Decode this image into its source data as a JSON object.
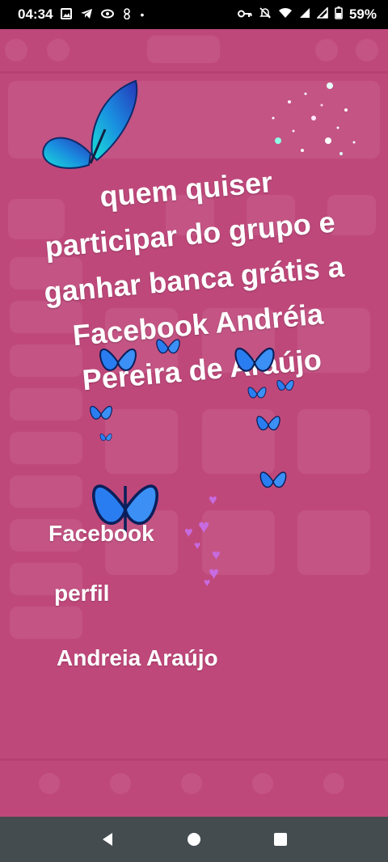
{
  "status_bar": {
    "time": "04:34",
    "battery": "59%",
    "left_icons": [
      "gallery-icon",
      "telegram-icon",
      "eye-icon",
      "app-icon",
      "dot-icon"
    ],
    "right_icons": [
      "key-icon",
      "mute-icon",
      "wifi-icon",
      "signal-icon",
      "signal-icon",
      "battery-icon"
    ]
  },
  "story": {
    "headline_lines": [
      "quem quiser",
      "participar do grupo e",
      "ganhar banca grátis a",
      "Facebook  Andréia",
      "Pereira de Araújo"
    ],
    "line1": "Facebook",
    "line2": "perfil",
    "line3": "Andreia Araújo",
    "background_color": "#bf487b"
  },
  "nav_bar": {
    "back_icon": "back-triangle-icon",
    "home_icon": "home-circle-icon",
    "recents_icon": "recents-square-icon"
  }
}
